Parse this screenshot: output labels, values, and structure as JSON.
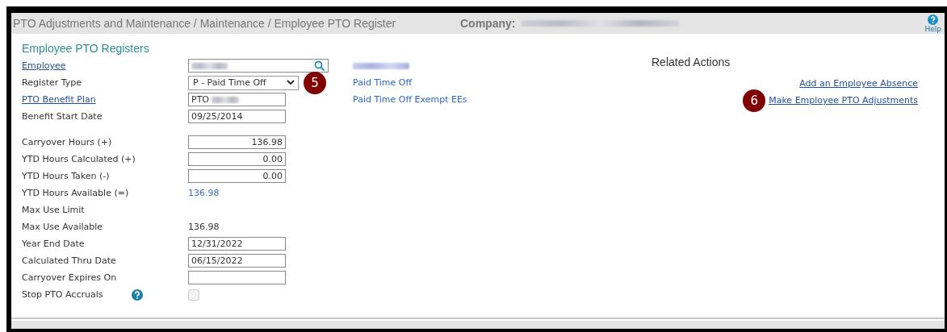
{
  "header": {
    "breadcrumb": "PTO Adjustments and Maintenance / Maintenance / Employee PTO Register",
    "company_label": "Company:",
    "help_label": "Help"
  },
  "section_title": "Employee PTO Registers",
  "field_groups": [
    [
      {
        "label": "Employee",
        "label_link": true,
        "kind": "search",
        "blurred": true
      },
      {
        "label": "Register Type",
        "label_link": false,
        "kind": "select",
        "value": "P - Paid Time Off",
        "callout": "5"
      },
      {
        "label": "PTO Benefit Plan",
        "label_link": true,
        "kind": "input",
        "value": "PTO",
        "blurred": true
      },
      {
        "label": "Benefit Start Date",
        "label_link": false,
        "kind": "input",
        "value": "09/25/2014"
      }
    ],
    [
      {
        "label": "Carryover Hours (+)",
        "label_link": false,
        "kind": "number",
        "value": "136.98"
      },
      {
        "label": "YTD Hours Calculated (+)",
        "label_link": false,
        "kind": "number",
        "value": "0.00"
      },
      {
        "label": "YTD Hours Taken (-)",
        "label_link": false,
        "kind": "number",
        "value": "0.00"
      },
      {
        "label": "YTD Hours Available (=)",
        "label_link": false,
        "kind": "computed",
        "value": "136.98"
      },
      {
        "label": "Max Use Limit",
        "label_link": false,
        "kind": "text"
      },
      {
        "label": "Max Use Available",
        "label_link": false,
        "kind": "text",
        "value": "136.98"
      },
      {
        "label": "Year End Date",
        "label_link": false,
        "kind": "input",
        "value": "12/31/2022"
      },
      {
        "label": "Calculated Thru Date",
        "label_link": false,
        "kind": "input",
        "value": "06/15/2022"
      },
      {
        "label": "Carryover Expires On",
        "label_link": false,
        "kind": "input"
      },
      {
        "label": "Stop PTO Accruals",
        "label_link": false,
        "kind": "checkbox",
        "checked": false,
        "disabled": true,
        "help": true
      }
    ]
  ],
  "plan_info": [
    "Paid Time Off",
    "Paid Time Off Exempt EEs"
  ],
  "related_actions": {
    "title": "Related Actions",
    "links": [
      {
        "label": "Add an Employee Absence"
      },
      {
        "label": "Make Employee PTO Adjustments",
        "callout": "6"
      }
    ]
  }
}
